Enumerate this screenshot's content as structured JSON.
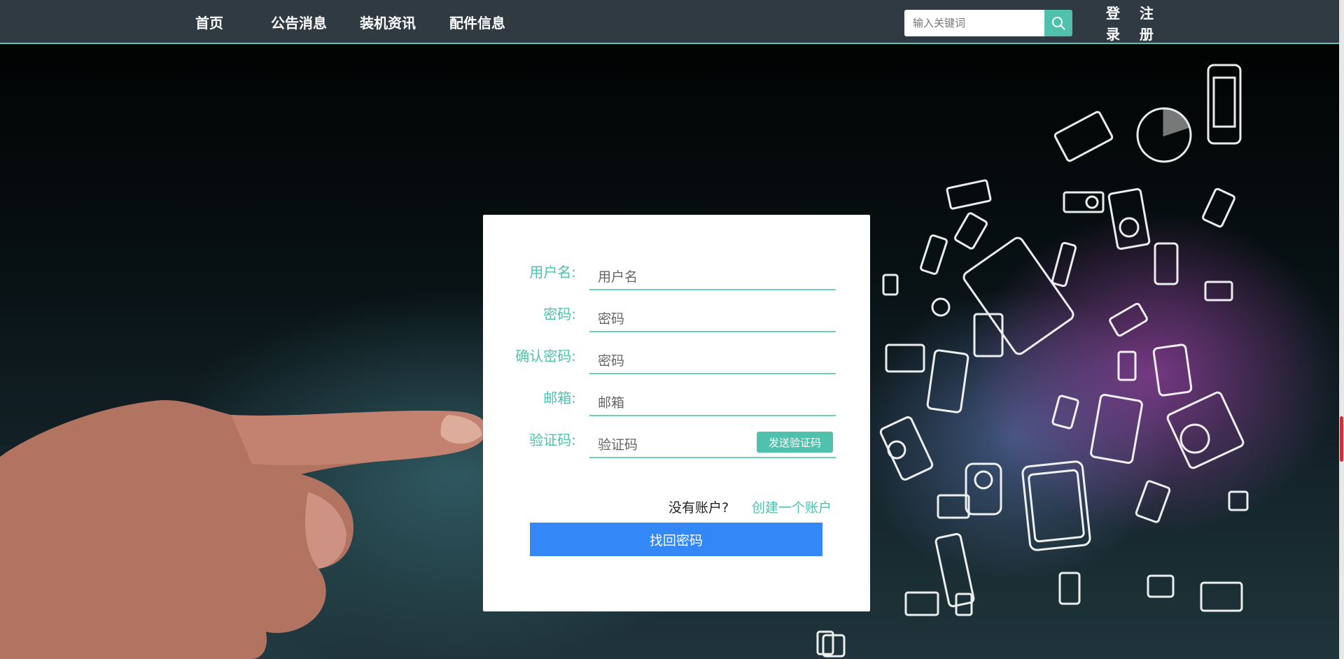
{
  "nav": {
    "items": [
      {
        "label": "首页"
      },
      {
        "label": "公告消息"
      },
      {
        "label": "装机资讯"
      },
      {
        "label": "配件信息"
      }
    ],
    "search": {
      "placeholder": "输入关键词",
      "icon": "search-icon"
    },
    "login": {
      "char1": "登",
      "char2": "录"
    },
    "register": {
      "char1": "注",
      "char2": "册"
    }
  },
  "form": {
    "username": {
      "label": "用户名:",
      "placeholder": "用户名"
    },
    "password": {
      "label": "密码:",
      "placeholder": "密码"
    },
    "confirm_password": {
      "label": "确认密码:",
      "placeholder": "密码"
    },
    "email": {
      "label": "邮箱:",
      "placeholder": "邮箱"
    },
    "code": {
      "label": "验证码:",
      "placeholder": "验证码",
      "send_label": "发送验证码"
    },
    "no_account": "没有账户?",
    "create_account": "创建一个账户",
    "submit_label": "找回密码"
  },
  "colors": {
    "nav_bg": "#303a43",
    "accent": "#4fc1ad",
    "primary_button": "#3387f6"
  }
}
